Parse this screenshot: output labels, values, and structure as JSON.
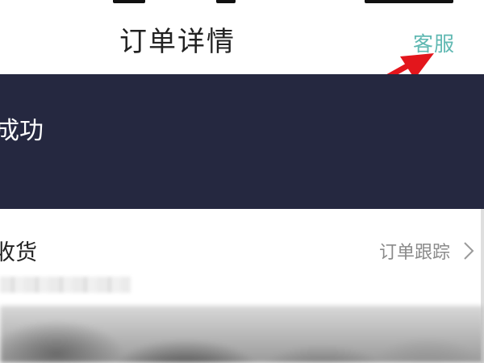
{
  "nav": {
    "title": "订单详情",
    "action_label": "客服"
  },
  "banner": {
    "status_text": "成功"
  },
  "shipping": {
    "status": "收货",
    "track_label": "订单跟踪"
  },
  "colors": {
    "banner_bg": "#252840",
    "accent": "#5fb8b2",
    "annotation_arrow": "#e3161c"
  },
  "icons": {
    "chevron": "chevron-right-icon",
    "arrow": "red-annotation-arrow"
  }
}
